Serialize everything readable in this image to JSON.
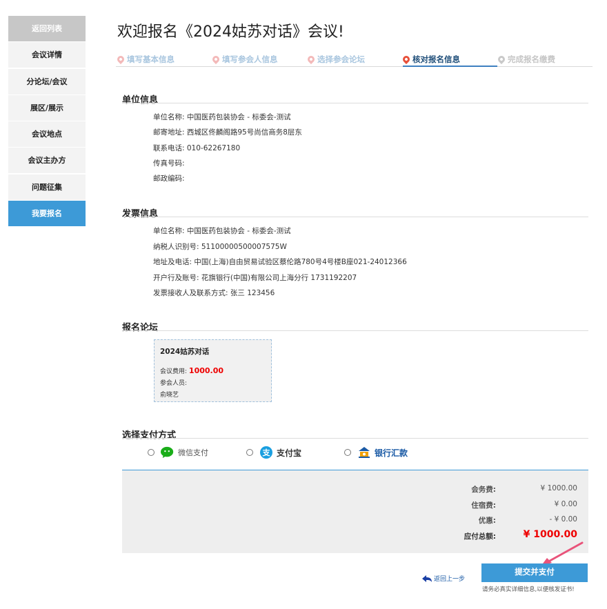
{
  "sidebar": {
    "items": [
      {
        "label": "返回列表"
      },
      {
        "label": "会议详情"
      },
      {
        "label": "分论坛/会议"
      },
      {
        "label": "展区/展示"
      },
      {
        "label": "会议地点"
      },
      {
        "label": "会议主办方"
      },
      {
        "label": "问题征集"
      },
      {
        "label": "我要报名"
      }
    ]
  },
  "header": {
    "title": "欢迎报名《2024姑苏对话》会议!"
  },
  "steps": [
    {
      "label": "填写基本信息"
    },
    {
      "label": "填写参会人信息"
    },
    {
      "label": "选择参会论坛"
    },
    {
      "label": "核对报名信息"
    },
    {
      "label": "完成报名缴费"
    }
  ],
  "unit": {
    "title": "单位信息",
    "lines": [
      "单位名称: 中国医药包装协会 - 标委会-测试",
      "邮寄地址: 西城区佟麟阁路95号尚信商务8层东",
      "联系电话: 010-62267180",
      "传真号码:",
      "邮政编码:"
    ]
  },
  "invoice": {
    "title": "发票信息",
    "lines": [
      "单位名称: 中国医药包装协会 - 标委会-测试",
      "纳税人识别号: 51100000500007575W",
      "地址及电话: 中国(上海)自由贸易试验区蔡伦路780号4号楼B座021-24012366",
      "开户行及账号: 花旗银行(中国)有限公司上海分行 1731192207",
      "发票接收人及联系方式: 张三 123456"
    ]
  },
  "forum": {
    "title": "报名论坛",
    "name": "2024姑苏对话",
    "fee_label": "会议费用:",
    "fee_value": "1000.00",
    "attendee_label": "参会人员:",
    "attendee": "俞晓艺"
  },
  "payment": {
    "title": "选择支付方式",
    "options": [
      {
        "label": "微信支付",
        "icon": "wechat-icon",
        "color": "#1aad19"
      },
      {
        "label": "支付宝",
        "icon": "alipay-icon",
        "color": "#1a9fe0"
      },
      {
        "label": "银行汇款",
        "icon": "bank-icon",
        "color": "#1a5aa5"
      }
    ]
  },
  "summary": {
    "rows": [
      {
        "label": "会务费:",
        "value": "¥ 1000.00"
      },
      {
        "label": "住宿费:",
        "value": "¥ 0.00"
      },
      {
        "label": "优惠:",
        "value": "- ¥ 0.00"
      },
      {
        "label": "应付总额:",
        "value": "¥ 1000.00"
      }
    ]
  },
  "footer": {
    "back_label": "返回上一步",
    "submit_label": "提交并支付",
    "hint": "请务必真实详细信息,以便核发证书!"
  },
  "colors": {
    "accent": "#3d9ad7",
    "price": "#e00000"
  }
}
